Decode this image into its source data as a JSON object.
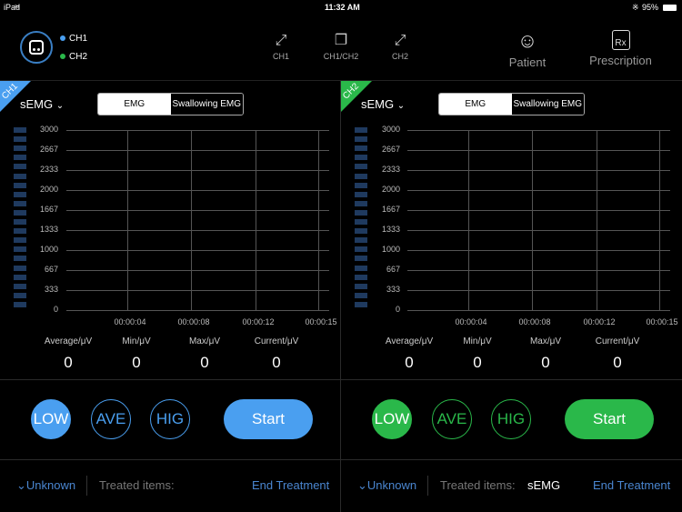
{
  "status": {
    "device": "iPad",
    "time": "11:32 AM",
    "battery": "95%"
  },
  "header": {
    "channels": [
      {
        "label": "CH1",
        "color": "#4a9ff0"
      },
      {
        "label": "CH2",
        "color": "#2ab84a"
      }
    ],
    "views": [
      {
        "label": "CH1",
        "icon": "expand-icon"
      },
      {
        "label": "CH1/CH2",
        "icon": "copy-icon"
      },
      {
        "label": "CH2",
        "icon": "expand-icon"
      }
    ],
    "patient": "Patient",
    "prescription": "Prescription",
    "rx": "Rx"
  },
  "panels": [
    {
      "badge": "CH1",
      "color": "#4a9ff0",
      "mode": "sEMG",
      "tabs": [
        "EMG",
        "Swallowing EMG"
      ],
      "active_tab": 0,
      "y_ticks": [
        "3000",
        "2667",
        "2333",
        "2000",
        "1667",
        "1333",
        "1000",
        "667",
        "333",
        "0"
      ],
      "x_ticks": [
        "00:00:04",
        "00:00:08",
        "00:00:12",
        "00:00:15"
      ],
      "stats": [
        {
          "label": "Average/μV",
          "value": "0"
        },
        {
          "label": "Min/μV",
          "value": "0"
        },
        {
          "label": "Max/μV",
          "value": "0"
        },
        {
          "label": "Current/μV",
          "value": "0"
        }
      ],
      "levels": [
        "LOW",
        "AVE",
        "HIG"
      ],
      "active_level": 0,
      "start": "Start",
      "unknown": "Unknown",
      "treated_label": "Treated items:",
      "treated_value": "",
      "end": "End Treatment"
    },
    {
      "badge": "CH2",
      "color": "#2ab84a",
      "mode": "sEMG",
      "tabs": [
        "EMG",
        "Swallowing EMG"
      ],
      "active_tab": 0,
      "y_ticks": [
        "3000",
        "2667",
        "2333",
        "2000",
        "1667",
        "1333",
        "1000",
        "667",
        "333",
        "0"
      ],
      "x_ticks": [
        "00:00:04",
        "00:00:08",
        "00:00:12",
        "00:00:15"
      ],
      "stats": [
        {
          "label": "Average/μV",
          "value": "0"
        },
        {
          "label": "Min/μV",
          "value": "0"
        },
        {
          "label": "Max/μV",
          "value": "0"
        },
        {
          "label": "Current/μV",
          "value": "0"
        }
      ],
      "levels": [
        "LOW",
        "AVE",
        "HIG"
      ],
      "active_level": 0,
      "start": "Start",
      "unknown": "Unknown",
      "treated_label": "Treated items:",
      "treated_value": "sEMG",
      "end": "End Treatment"
    }
  ]
}
